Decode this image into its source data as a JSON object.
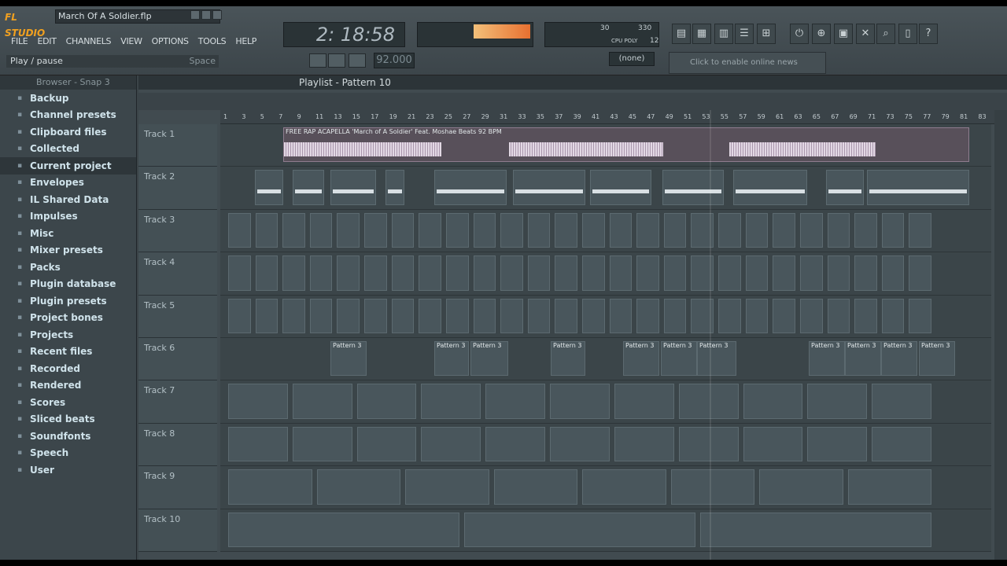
{
  "app": {
    "name": "FL STUDIO",
    "project": "March Of A Soldier.flp"
  },
  "menu": [
    "FILE",
    "EDIT",
    "CHANNELS",
    "VIEW",
    "OPTIONS",
    "TOOLS",
    "HELP"
  ],
  "hint": {
    "text": "Play / pause",
    "shortcut": "Space"
  },
  "transport": {
    "time": "2: 18:58",
    "tempo": "92.000",
    "cpu_a": "30",
    "cpu_b": "330",
    "cpu_label": "CPU POLY",
    "poly": "12",
    "pattern": "(none)",
    "news": "Click to enable online news"
  },
  "browser": {
    "title": "Browser - Snap 3",
    "items": [
      "Backup",
      "Channel presets",
      "Clipboard files",
      "Collected",
      "Current project",
      "Envelopes",
      "IL Shared Data",
      "Impulses",
      "Misc",
      "Mixer presets",
      "Packs",
      "Plugin database",
      "Plugin presets",
      "Project bones",
      "Projects",
      "Recent files",
      "Recorded",
      "Rendered",
      "Scores",
      "Sliced beats",
      "Soundfonts",
      "Speech",
      "User"
    ],
    "icons": [
      "folder-icon",
      "folder-icon",
      "folder-icon",
      "folder-icon",
      "folder-icon",
      "folder-icon",
      "folder-icon",
      "folder-icon",
      "folder-icon",
      "folder-icon",
      "folder-icon",
      "folder-icon",
      "folder-icon",
      "folder-icon",
      "folder-icon",
      "folder-icon",
      "folder-icon",
      "folder-icon",
      "folder-icon",
      "folder-icon",
      "folder-icon",
      "folder-icon",
      "folder-icon"
    ]
  },
  "playlist": {
    "title": "Playlist - Pattern 10",
    "audio_clip": "FREE RAP ACAPELLA 'March of A Soldier' Feat. Moshae Beats 92 BPM",
    "pattern_label": "Pattern 3",
    "tracks": [
      "Track 1",
      "Track 2",
      "Track 3",
      "Track 4",
      "Track 5",
      "Track 6",
      "Track 7",
      "Track 8",
      "Track 9",
      "Track 10"
    ],
    "ruler": [
      "1",
      "3",
      "5",
      "7",
      "9",
      "11",
      "13",
      "15",
      "17",
      "19",
      "21",
      "23",
      "25",
      "27",
      "29",
      "31",
      "33",
      "35",
      "37",
      "39",
      "41",
      "43",
      "45",
      "47",
      "49",
      "51",
      "53",
      "55",
      "57",
      "59",
      "61",
      "63",
      "65",
      "67",
      "69",
      "71",
      "73",
      "75",
      "77",
      "79",
      "81",
      "83"
    ]
  }
}
